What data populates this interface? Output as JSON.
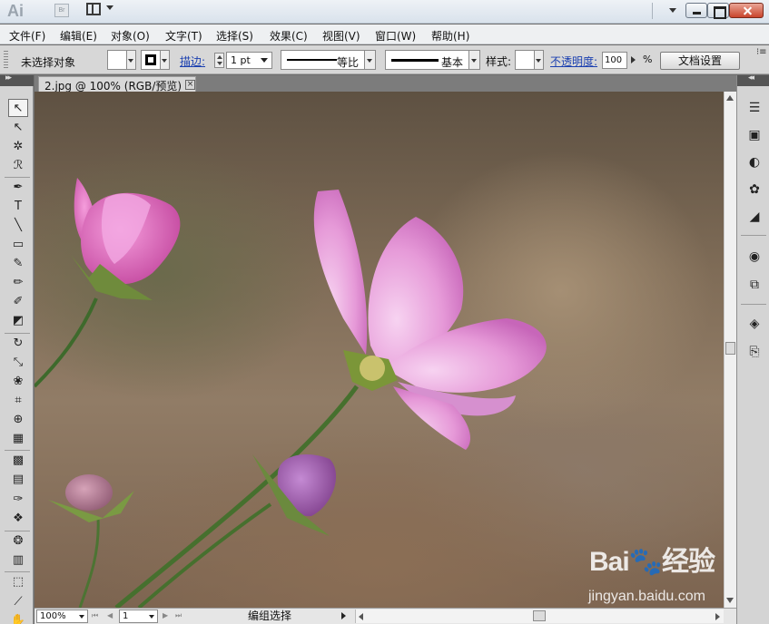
{
  "titlebar": {
    "app_logo": "Ai",
    "bridge_label": "Br"
  },
  "menu": [
    {
      "label": "文件(F)"
    },
    {
      "label": "编辑(E)"
    },
    {
      "label": "对象(O)"
    },
    {
      "label": "文字(T)"
    },
    {
      "label": "选择(S)"
    },
    {
      "label": "效果(C)"
    },
    {
      "label": "视图(V)"
    },
    {
      "label": "窗口(W)"
    },
    {
      "label": "帮助(H)"
    }
  ],
  "control_bar": {
    "selection_status": "未选择对象",
    "stroke_label": "描边:",
    "stroke_weight": "1 pt",
    "profile_scale": "等比",
    "brush_basic": "基本",
    "style_label": "样式:",
    "opacity_label": "不透明度:",
    "opacity_value": "100",
    "percent": "%",
    "doc_settings": "文档设置"
  },
  "document": {
    "tab_title": "2.jpg @ 100% (RGB/预览)",
    "tab_close": "×"
  },
  "status_bar": {
    "zoom": "100%",
    "page": "1",
    "status_text": "编组选择"
  },
  "watermark": {
    "logo": "Bai🐾经验",
    "url": "jingyan.baidu.com"
  },
  "tools": [
    {
      "name": "selection-tool",
      "glyph": "↖"
    },
    {
      "name": "direct-selection-tool",
      "glyph": "↖"
    },
    {
      "name": "magic-wand-tool",
      "glyph": "✲"
    },
    {
      "name": "lasso-tool",
      "glyph": "ℛ"
    },
    {
      "name": "pen-tool",
      "glyph": "✒"
    },
    {
      "name": "type-tool",
      "glyph": "T"
    },
    {
      "name": "line-segment-tool",
      "glyph": "╲"
    },
    {
      "name": "rectangle-tool",
      "glyph": "▭"
    },
    {
      "name": "paintbrush-tool",
      "glyph": "✎"
    },
    {
      "name": "pencil-tool",
      "glyph": "✏"
    },
    {
      "name": "blob-brush-tool",
      "glyph": "✐"
    },
    {
      "name": "eraser-tool",
      "glyph": "◩"
    },
    {
      "name": "rotate-tool",
      "glyph": "↻"
    },
    {
      "name": "scale-tool",
      "glyph": "⤡"
    },
    {
      "name": "warp-tool",
      "glyph": "❀"
    },
    {
      "name": "free-transform-tool",
      "glyph": "⌗"
    },
    {
      "name": "shape-builder-tool",
      "glyph": "⊕"
    },
    {
      "name": "perspective-grid-tool",
      "glyph": "▦"
    },
    {
      "name": "mesh-tool",
      "glyph": "▩"
    },
    {
      "name": "gradient-tool",
      "glyph": "▤"
    },
    {
      "name": "eyedropper-tool",
      "glyph": "✑"
    },
    {
      "name": "blend-tool",
      "glyph": "❖"
    },
    {
      "name": "symbol-sprayer-tool",
      "glyph": "❂"
    },
    {
      "name": "column-graph-tool",
      "glyph": "▥"
    },
    {
      "name": "artboard-tool",
      "glyph": "⬚"
    },
    {
      "name": "slice-tool",
      "glyph": "⟋"
    },
    {
      "name": "hand-tool",
      "glyph": "✋"
    }
  ],
  "dock": [
    {
      "name": "color-panel-icon",
      "glyph": "☰"
    },
    {
      "name": "color-guide-icon",
      "glyph": "▣"
    },
    {
      "name": "swatches-icon",
      "glyph": "◐"
    },
    {
      "name": "brushes-icon",
      "glyph": "✿"
    },
    {
      "name": "symbols-icon",
      "glyph": "◢"
    },
    {
      "name": "appearance-icon",
      "glyph": "◉"
    },
    {
      "name": "graphic-styles-icon",
      "glyph": "⧉"
    },
    {
      "name": "layers-icon",
      "glyph": "◈"
    },
    {
      "name": "artboards-icon",
      "glyph": "⎘"
    }
  ]
}
